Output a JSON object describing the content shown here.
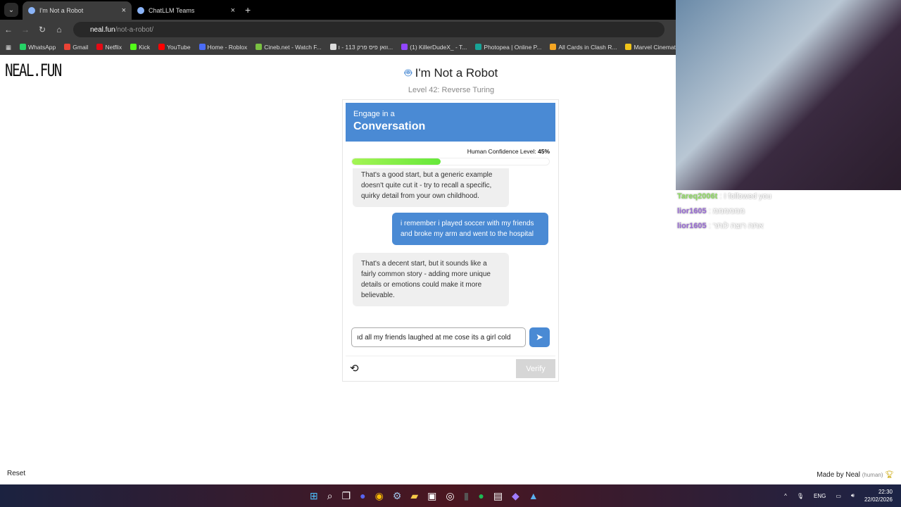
{
  "browser": {
    "tabs": [
      {
        "label": "I'm Not a Robot",
        "active": true
      },
      {
        "label": "ChatLLM Teams",
        "active": false
      }
    ],
    "url_host": "neal.fun",
    "url_path": "/not-a-robot/",
    "bookmarks": [
      {
        "label": "WhatsApp",
        "color": "#25d366"
      },
      {
        "label": "Gmail",
        "color": "#ea4335"
      },
      {
        "label": "Netflix",
        "color": "#e50914"
      },
      {
        "label": "Kick",
        "color": "#53fc18"
      },
      {
        "label": "YouTube",
        "color": "#ff0000"
      },
      {
        "label": "Home - Roblox",
        "color": "#4a6cf7"
      },
      {
        "label": "Cineb.net - Watch F...",
        "color": "#7ac142"
      },
      {
        "label": "וואן פיס פרק 113 - ו...",
        "color": "#dddddd"
      },
      {
        "label": "(1) KillerDudeX_ - T...",
        "color": "#9146ff"
      },
      {
        "label": "Photopea | Online P...",
        "color": "#18a497"
      },
      {
        "label": "All Cards in Clash R...",
        "color": "#f5a623"
      },
      {
        "label": "Marvel Cinematic",
        "color": "#f0c419"
      }
    ]
  },
  "site": {
    "logo": "NEAL.FUN",
    "title": "I'm Not a Robot",
    "level": "Level 42: Reverse Turing",
    "reset": "Reset",
    "made_by": "Made by Neal",
    "made_by_note": "(human)"
  },
  "card": {
    "header_small": "Engage in a",
    "header_big": "Conversation",
    "confidence_label": "Human Confidence Level:",
    "confidence_value": "45%",
    "confidence_percent": 45,
    "accent": "#4a8ad4",
    "messages": [
      {
        "from": "bot",
        "text": "That's a good start, but a generic example doesn't quite cut it - try to recall a specific, quirky detail from your own childhood."
      },
      {
        "from": "user",
        "text": "i remember i played soccer with my friends and broke my arm and went to the hospital"
      },
      {
        "from": "bot",
        "text": "That's a decent start, but it sounds like a fairly common story - adding more unique details or emotions could make it more believable."
      }
    ],
    "input_value": "ıd all my friends laughed at me cose its a girl cold",
    "verify": "Verify"
  },
  "stream_chat": [
    {
      "user": "Tareq2006t",
      "text": "I followed you"
    },
    {
      "user": "lior1605",
      "text": "ממממממ"
    },
    {
      "user": "lior1605",
      "text": "אתה רוצה לותר"
    }
  ],
  "taskbar": {
    "language": "ENG",
    "time": "22:30",
    "date": "22/02/2026"
  }
}
